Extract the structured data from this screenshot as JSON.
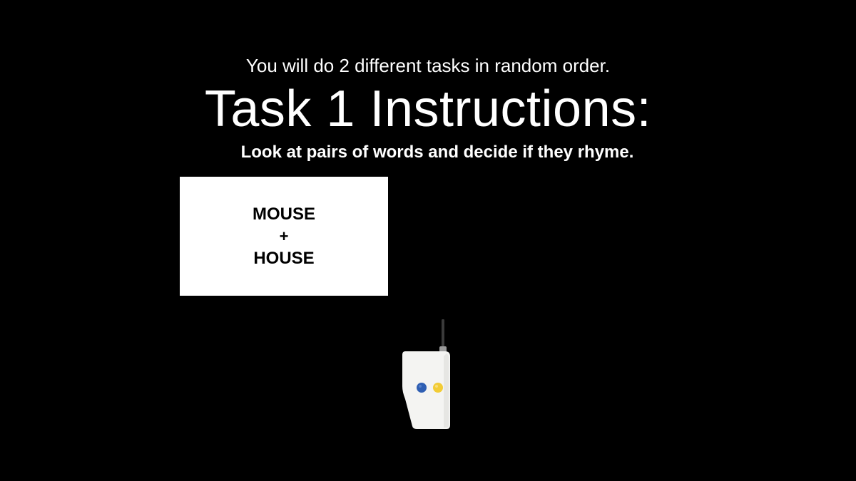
{
  "intro": {
    "text": "You will do 2 different tasks in random order."
  },
  "task": {
    "title": "Task 1 Instructions:",
    "description": "Look at pairs of words and decide if they rhyme."
  },
  "stimulus": {
    "word1": "MOUSE",
    "separator": "+",
    "word2": "HOUSE"
  },
  "response_device": {
    "icon": "button-box-icon",
    "buttons": [
      {
        "name": "left-button",
        "color": "#2f5fb3"
      },
      {
        "name": "right-button",
        "color": "#f2cc36"
      }
    ]
  },
  "colors": {
    "background": "#000000",
    "text": "#ffffff",
    "card": "#ffffff"
  }
}
